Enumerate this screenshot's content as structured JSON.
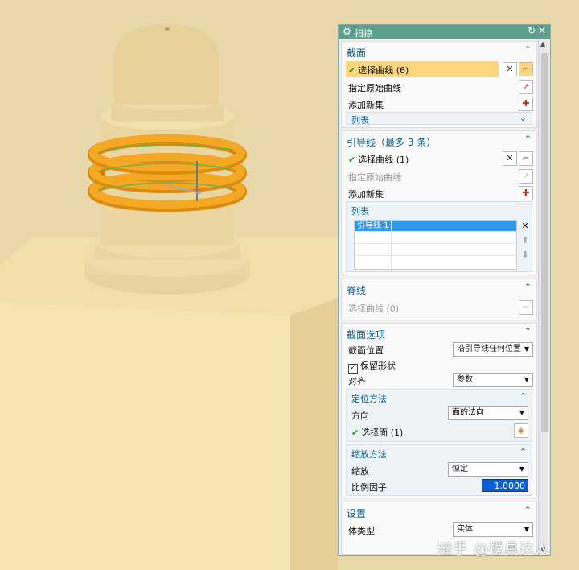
{
  "dialog": {
    "title": "扫掠",
    "section": {
      "title": "截面",
      "select_curve": "选择曲线 (6)",
      "specify_origin": "指定原始曲线",
      "add_new_set": "添加新集",
      "list": "列表"
    },
    "guide": {
      "title": "引导线（最多 3 条）",
      "select_curve": "选择曲线 (1)",
      "specify_origin": "指定原始曲线",
      "add_new_set": "添加新集",
      "list": "列表",
      "rows": [
        "引导线 1"
      ]
    },
    "spine": {
      "title": "脊线",
      "select_curve": "选择曲线 (0)"
    },
    "section_options": {
      "title": "截面选项",
      "position_label": "截面位置",
      "position_value": "沿引导线任何位置",
      "preserve_shape": "保留形状",
      "align_label": "对齐",
      "align_value": "参数",
      "orient": {
        "title": "定位方法",
        "direction_label": "方向",
        "direction_value": "面的法向",
        "select_face": "选择面 (1)"
      },
      "scale": {
        "title": "缩放方法",
        "scale_label": "缩放",
        "scale_value": "恒定",
        "factor_label": "比例因子",
        "factor_value": "1.0000"
      }
    },
    "settings": {
      "title": "设置",
      "body_type_label": "体类型",
      "body_type_value": "实体"
    }
  },
  "watermark": "知乎 @模具达人",
  "colors": {
    "title_bar": "#5e9e8c",
    "header_text": "#0b5f8a",
    "highlight": "#fbd67f",
    "selection": "#3399e8",
    "model": "#e9d7a8",
    "spring": "#f0a020"
  }
}
